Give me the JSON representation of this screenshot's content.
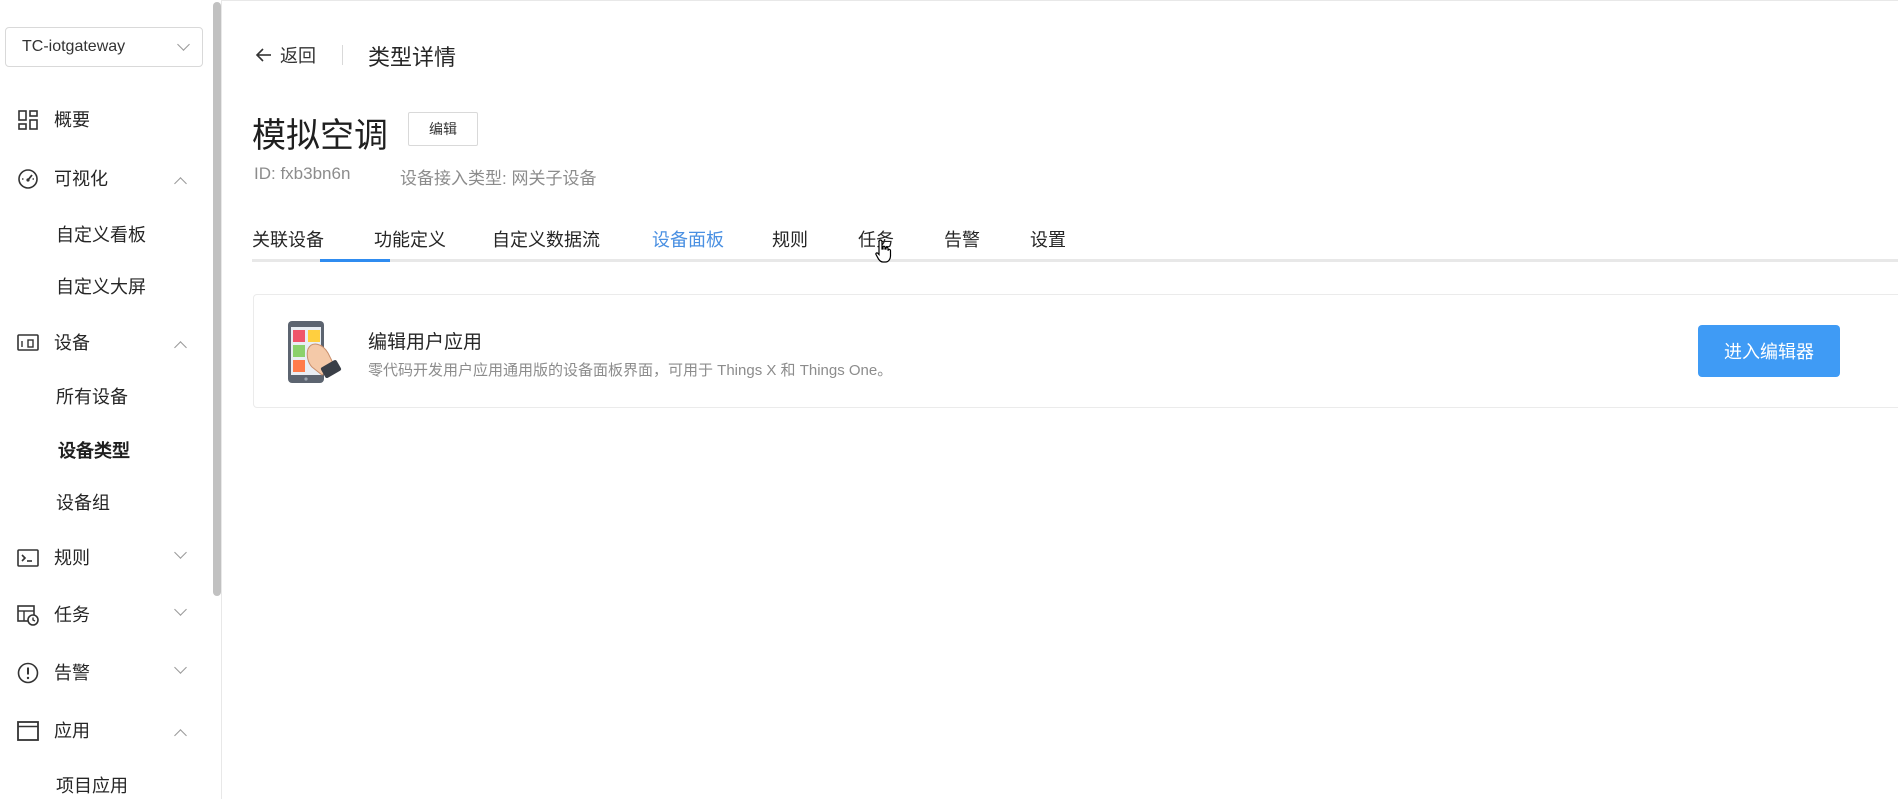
{
  "sidebar": {
    "project_select": "TC-iotgateway",
    "nav": {
      "overview": "概要",
      "visualization": "可视化",
      "custom_dashboard": "自定义看板",
      "custom_screen": "自定义大屏",
      "devices": "设备",
      "all_devices": "所有设备",
      "device_types": "设备类型",
      "device_groups": "设备组",
      "rules": "规则",
      "tasks": "任务",
      "alerts": "告警",
      "apps": "应用",
      "project_apps": "项目应用"
    }
  },
  "header": {
    "back": "返回",
    "page_title": "类型详情"
  },
  "device": {
    "name": "模拟空调",
    "edit": "编辑",
    "id": "ID: fxb3bn6n",
    "access_type": "设备接入类型: 网关子设备"
  },
  "tabs": [
    "关联设备",
    "功能定义",
    "自定义数据流",
    "设备面板",
    "规则",
    "任务",
    "告警",
    "设置"
  ],
  "card": {
    "title": "编辑用户应用",
    "description": "零代码开发用户应用通用版的设备面板界面，可用于 Things X 和 Things One。",
    "button": "进入编辑器"
  },
  "colors": {
    "accent": "#3f9bf5",
    "active_tab": "#4a90e2",
    "active_tab_underline": "#2f8cf0"
  },
  "icons": [
    "chevron-down-icon",
    "dashboard-grid-icon",
    "gauge-icon",
    "device-icon",
    "terminal-icon",
    "task-clock-icon",
    "alert-circle-icon",
    "window-icon",
    "arrow-left-icon",
    "app-edit-illustration",
    "pointer-cursor-icon"
  ]
}
